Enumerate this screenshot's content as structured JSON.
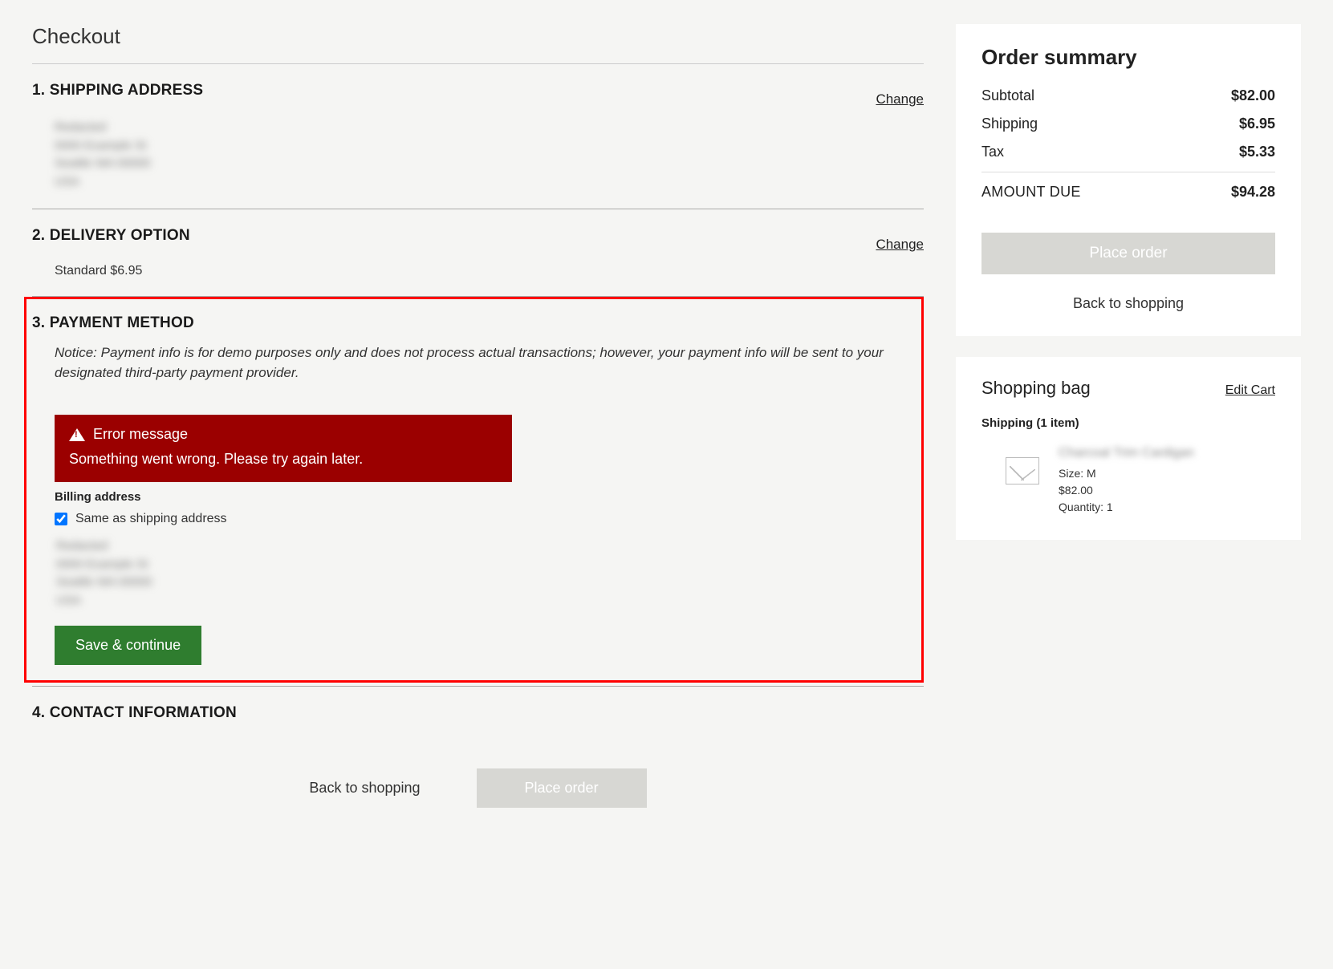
{
  "page": {
    "title": "Checkout"
  },
  "steps": {
    "shipping": {
      "title": "1. SHIPPING ADDRESS",
      "change": "Change",
      "masked": "Redacted\n0000 Example St\nSeattle WA 00000\nUSA"
    },
    "delivery": {
      "title": "2. DELIVERY OPTION",
      "change": "Change",
      "line": "Standard  $6.95"
    },
    "payment": {
      "title": "3. PAYMENT METHOD",
      "notice": "Notice: Payment info is for demo purposes only and does not process actual transactions; however, your payment info will be sent to your designated third-party payment provider.",
      "error_title": "Error message",
      "error_body": "Something went wrong. Please try again later.",
      "billing_label": "Billing address",
      "same_as": "Same as shipping address",
      "masked": "Redacted\n0000 Example St\nSeattle WA 00000\nUSA",
      "save_btn": "Save & continue"
    },
    "contact": {
      "title": "4. CONTACT INFORMATION"
    }
  },
  "bottom": {
    "back": "Back to shopping",
    "place": "Place order"
  },
  "summary": {
    "title": "Order summary",
    "rows": {
      "subtotal_label": "Subtotal",
      "subtotal_value": "$82.00",
      "shipping_label": "Shipping",
      "shipping_value": "$6.95",
      "tax_label": "Tax",
      "tax_value": "$5.33",
      "due_label": "AMOUNT DUE",
      "due_value": "$94.28"
    },
    "place": "Place order",
    "back": "Back to shopping"
  },
  "bag": {
    "title": "Shopping bag",
    "edit": "Edit Cart",
    "ship_count": "Shipping (1 item)",
    "item": {
      "name": "Charcoal Trim Cardigan",
      "size": "Size: M",
      "price": "$82.00",
      "qty": "Quantity: 1"
    }
  }
}
